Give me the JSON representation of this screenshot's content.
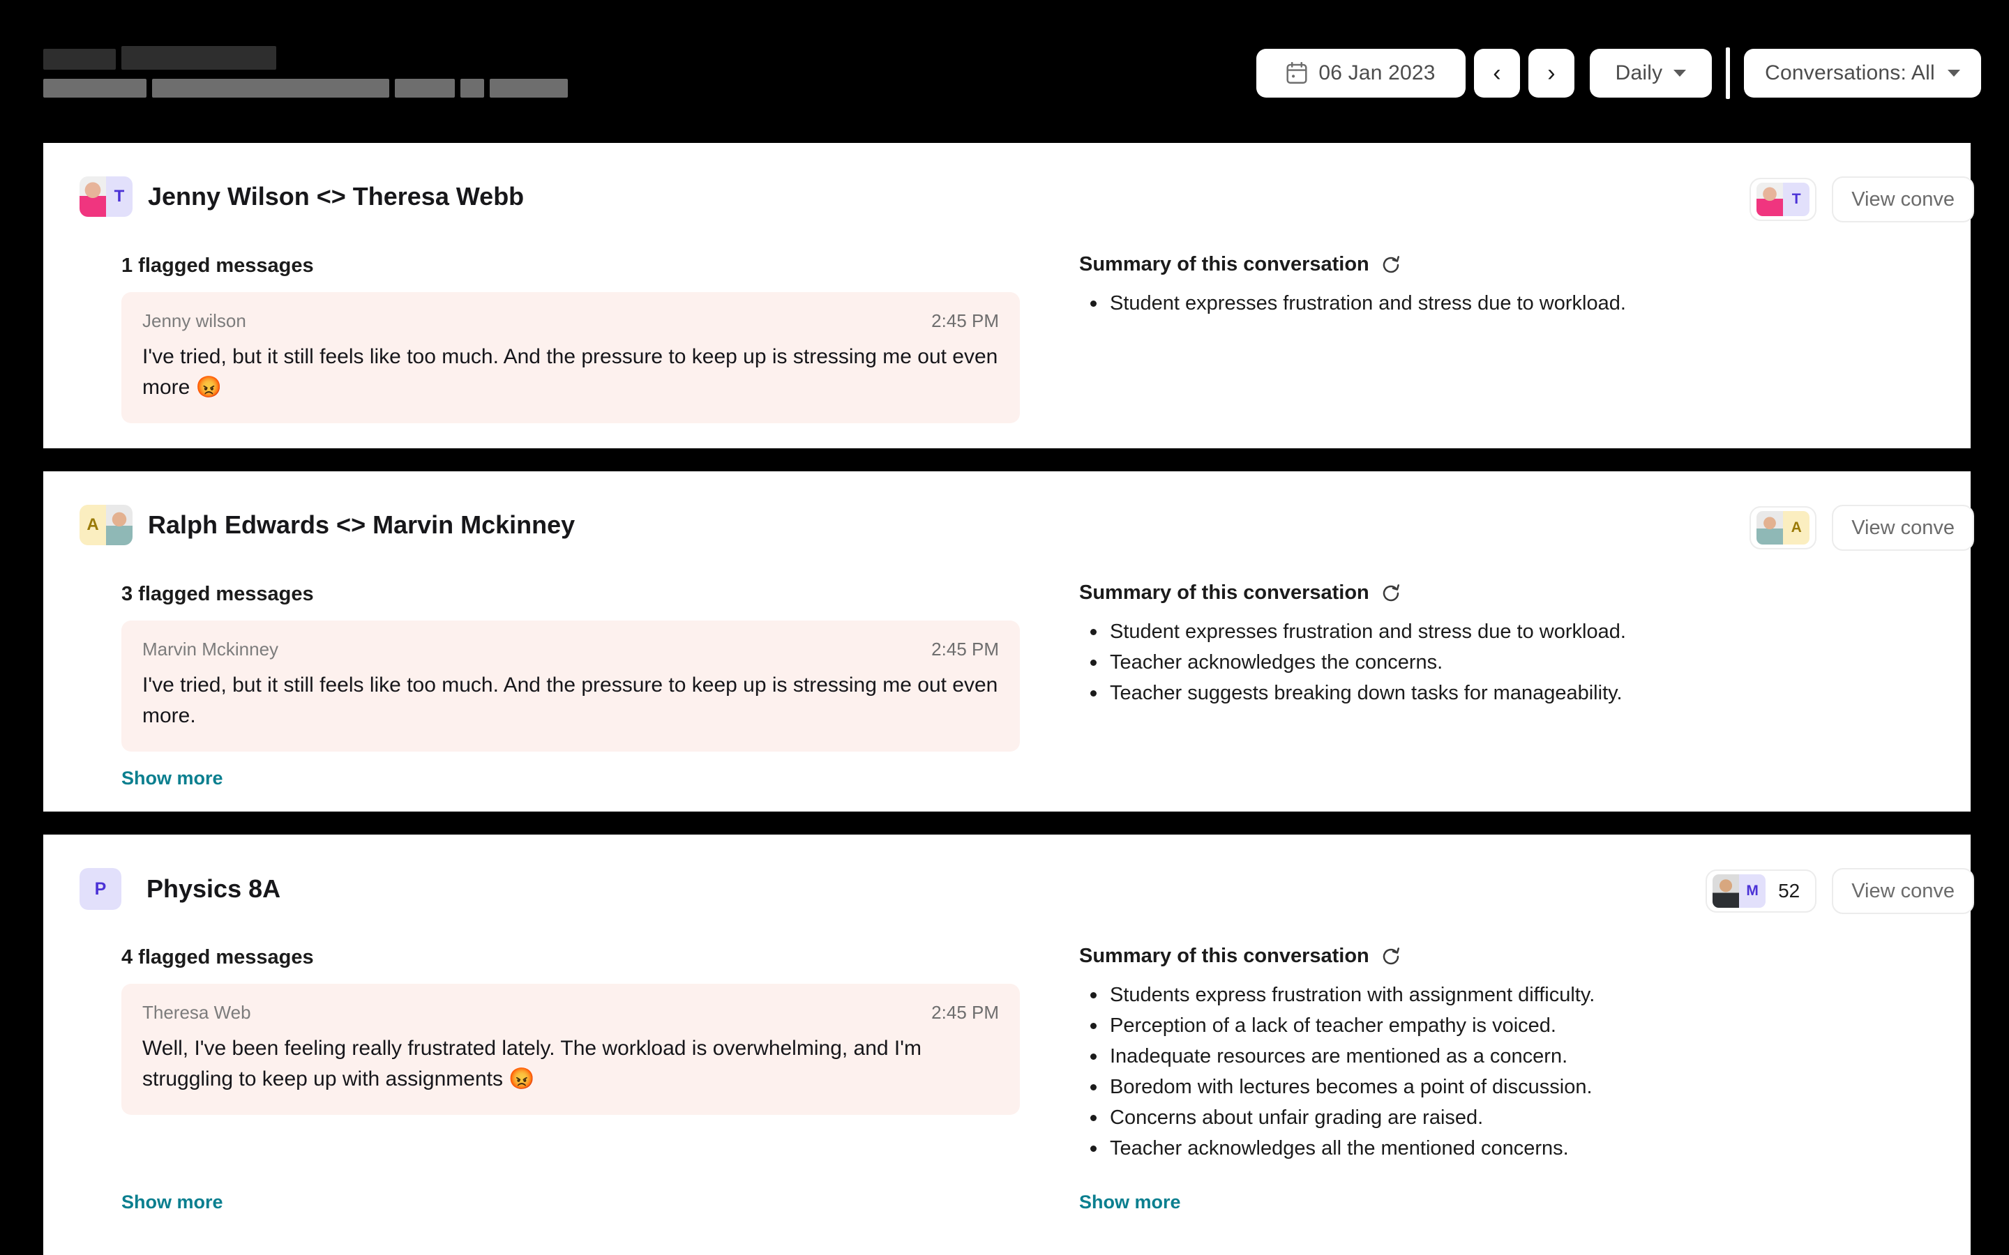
{
  "header": {
    "title_redacted": true,
    "redacted_title_blocks": [
      104,
      30,
      222
    ],
    "redacted_sub_blocks": [
      148,
      2,
      340,
      2,
      86,
      2,
      112
    ],
    "date_value": "06 Jan 2023",
    "calendar_icon": "calendar-icon",
    "prev_label": "‹",
    "next_label": "›",
    "period_label": "Daily",
    "conversations_filter_label": "Conversations: All",
    "dropdown_icon": "chevron-down-icon"
  },
  "cards": [
    {
      "id": "card1",
      "title": "Jenny Wilson <> Theresa Webb",
      "avatars": [
        {
          "type": "photo",
          "name": "jenny",
          "class": "photo-jenny"
        },
        {
          "type": "letter",
          "label": "T",
          "color": "purple"
        }
      ],
      "head_avatars": [
        {
          "type": "photo",
          "name": "jenny",
          "class": "photo-jenny"
        },
        {
          "type": "letter",
          "label": "T",
          "color": "purple"
        }
      ],
      "participant_count": "",
      "view_button_label": "View conve",
      "flagged_label": "1 flagged messages",
      "message": {
        "author": "Jenny wilson",
        "time": "2:45 PM",
        "text": "I've tried, but it still feels like too much. And the pressure to keep up is stressing me out even more 😡"
      },
      "summary_title": "Summary of this conversation",
      "refresh_icon": "refresh-icon",
      "summary_bullets": [
        "Student expresses frustration and stress due to workload."
      ],
      "show_more_left": "",
      "show_more_right": ""
    },
    {
      "id": "card2",
      "title": "Ralph Edwards <> Marvin Mckinney",
      "avatars": [
        {
          "type": "letter",
          "label": "A",
          "color": "yellow"
        },
        {
          "type": "photo",
          "name": "ralph",
          "class": "photo-ralph"
        }
      ],
      "head_avatars": [
        {
          "type": "photo",
          "name": "ralph",
          "class": "photo-ralph"
        },
        {
          "type": "letter",
          "label": "A",
          "color": "yellow"
        }
      ],
      "participant_count": "",
      "view_button_label": "View conve",
      "flagged_label": "3 flagged messages",
      "message": {
        "author": "Marvin Mckinney",
        "time": "2:45 PM",
        "text": "I've tried, but it still feels like too much. And the pressure to keep up is stressing me out even more."
      },
      "summary_title": "Summary of this conversation",
      "refresh_icon": "refresh-icon",
      "summary_bullets": [
        "Student expresses frustration and stress due to workload.",
        "Teacher acknowledges the concerns.",
        "Teacher suggests breaking down tasks for manageability."
      ],
      "show_more_left": "Show more",
      "show_more_right": ""
    },
    {
      "id": "card3",
      "title": "Physics 8A",
      "avatars": [
        {
          "type": "square",
          "label": "P",
          "color": "purple"
        }
      ],
      "head_avatars": [
        {
          "type": "photo",
          "name": "marvin",
          "class": "photo-marvin"
        },
        {
          "type": "letter",
          "label": "M",
          "color": "purple"
        }
      ],
      "participant_count": "52",
      "view_button_label": "View conve",
      "flagged_label": "4 flagged messages",
      "message": {
        "author": "Theresa Web",
        "time": "2:45 PM",
        "text": "Well, I've been feeling really frustrated lately. The workload is overwhelming, and I'm struggling to keep up with assignments 😡"
      },
      "summary_title": "Summary of this conversation",
      "refresh_icon": "refresh-icon",
      "summary_bullets": [
        "Students express frustration with assignment difficulty.",
        "Perception of a lack of teacher empathy is voiced.",
        "Inadequate resources are mentioned as a concern.",
        "Boredom with lectures becomes a point of discussion.",
        "Concerns about unfair grading are raised.",
        "Teacher acknowledges all the mentioned concerns."
      ],
      "show_more_left": "Show more",
      "show_more_right": "Show more"
    }
  ],
  "colors": {
    "page_background": "#000000",
    "card_background": "#ffffff",
    "flagged_bubble": "#fdf1ee",
    "link_teal": "#0b7f8f",
    "avatar_purple_bg": "#e2e0fb",
    "avatar_purple_fg": "#4b32d6",
    "avatar_yellow_bg": "#fbeec0",
    "avatar_yellow_fg": "#9a7a07"
  }
}
